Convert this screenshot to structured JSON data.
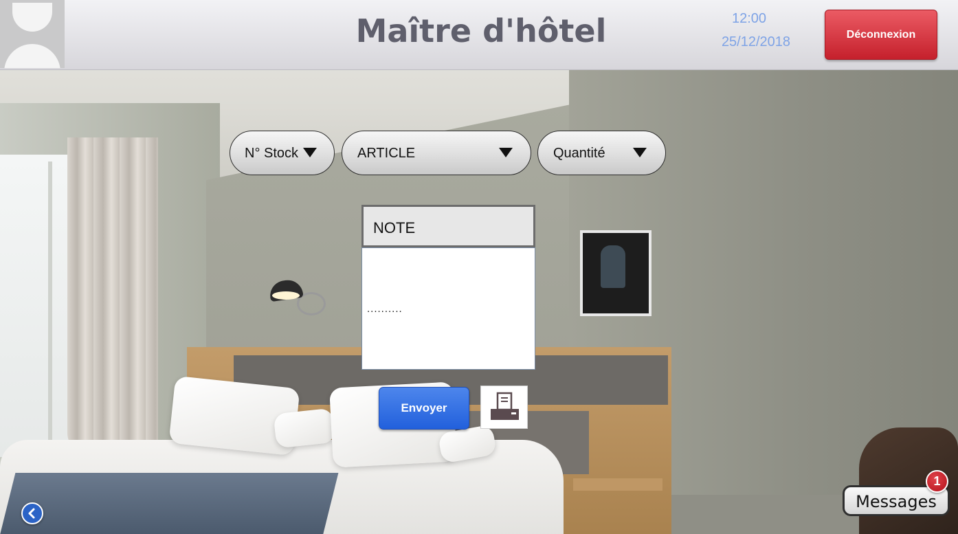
{
  "header": {
    "title": "Maître d'hôtel",
    "time": "12:00",
    "date": "25/12/2018",
    "logout_label": "Déconnexion"
  },
  "filters": {
    "stock_label": "N° Stock",
    "article_label": "ARTICLE",
    "quantity_label": "Quantité"
  },
  "note": {
    "header_label": "NOTE",
    "body_text": ".........."
  },
  "actions": {
    "send_label": "Envoyer"
  },
  "messages": {
    "label": "Messages",
    "unread_count": "1"
  },
  "icons": {
    "avatar": "user-avatar-icon",
    "print": "printer-icon",
    "back": "chevron-left-icon",
    "dropdown": "caret-down-icon"
  },
  "colors": {
    "logout_red": "#c5202c",
    "send_blue": "#2260dc",
    "clock_blue": "#7ea3e6",
    "title_gray": "#5f5f6c",
    "badge_red": "#b4121b"
  }
}
